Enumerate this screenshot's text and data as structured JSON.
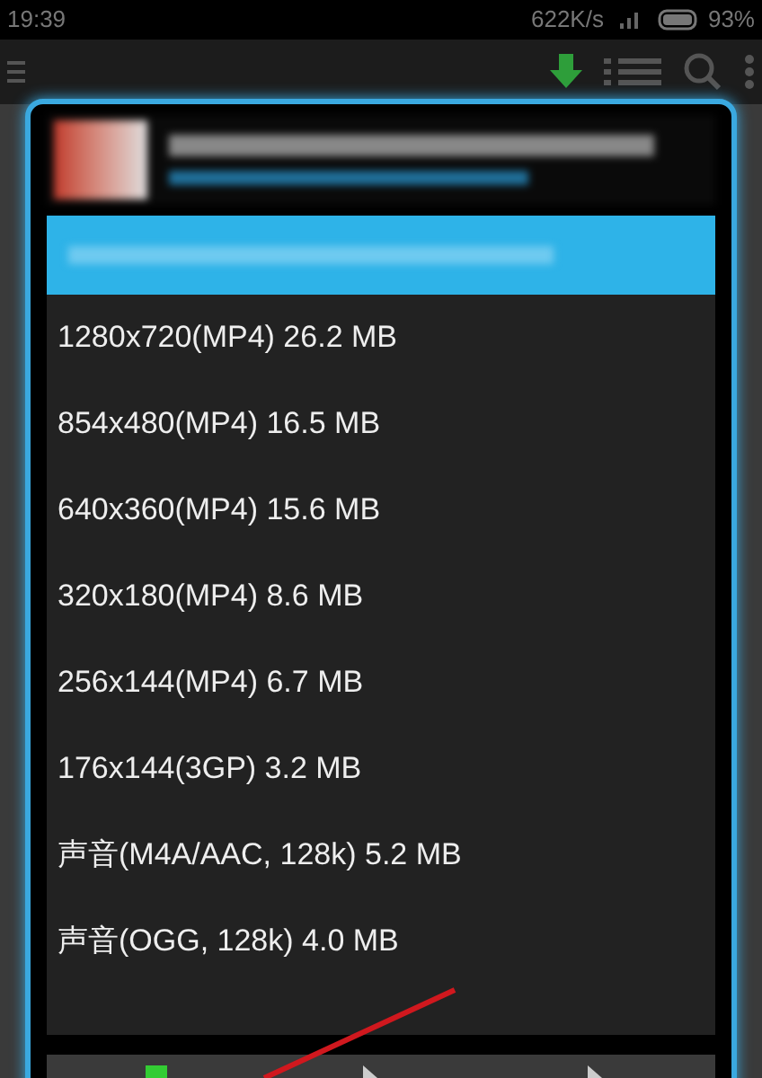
{
  "status_bar": {
    "time": "19:39",
    "speed": "622K/s",
    "battery": "93%"
  },
  "dialog": {
    "options": [
      {
        "kind": "redacted",
        "selected": true
      },
      {
        "kind": "text",
        "label": "1280x720(MP4) 26.2 MB",
        "selected": false
      },
      {
        "kind": "text",
        "label": "854x480(MP4) 16.5 MB",
        "selected": false
      },
      {
        "kind": "text",
        "label": "640x360(MP4) 15.6 MB",
        "selected": false
      },
      {
        "kind": "text",
        "label": "320x180(MP4) 8.6 MB",
        "selected": false
      },
      {
        "kind": "text",
        "label": "256x144(MP4) 6.7 MB",
        "selected": false
      },
      {
        "kind": "text",
        "label": "176x144(3GP) 3.2 MB",
        "selected": false
      },
      {
        "kind": "text",
        "label": "声音(M4A/AAC, 128k) 5.2 MB",
        "selected": false
      },
      {
        "kind": "text",
        "label": "声音(OGG, 128k) 4.0 MB",
        "selected": false
      }
    ]
  }
}
